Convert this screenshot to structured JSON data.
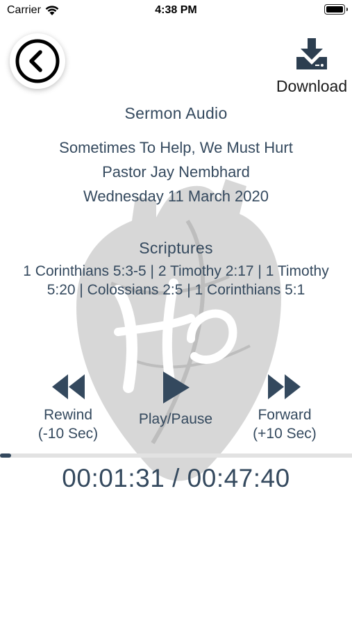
{
  "status_bar": {
    "carrier": "Carrier",
    "time": "4:38 PM",
    "wifi_icon": "wifi-icon",
    "battery_icon": "battery-icon"
  },
  "header": {
    "back_icon": "chevron-left-icon",
    "download_icon": "download-icon",
    "download_label": "Download"
  },
  "sermon": {
    "section_title": "Sermon Audio",
    "title": "Sometimes To Help, We Must Hurt",
    "speaker": "Pastor Jay Nembhard",
    "date": "Wednesday 11 March 2020"
  },
  "scriptures": {
    "section_title": "Scriptures",
    "text": "1 Corinthians 5:3-5 | 2 Timothy 2:17 | 1 Timothy 5:20 | Colossians 2:5 | 1 Corinthians 5:1"
  },
  "controls": {
    "rewind_icon": "rewind-icon",
    "rewind_label": "Rewind",
    "rewind_sub": "(-10 Sec)",
    "play_icon": "play-icon",
    "play_label": "Play/Pause",
    "forward_icon": "fast-forward-icon",
    "forward_label": "Forward",
    "forward_sub": "(+10 Sec)"
  },
  "player": {
    "progress_fraction": 0.032,
    "time_display": "00:01:31 / 00:47:40"
  },
  "colors": {
    "text": "#34495e",
    "watermark": "#cfcfcf",
    "track": "#e2e2e2"
  }
}
